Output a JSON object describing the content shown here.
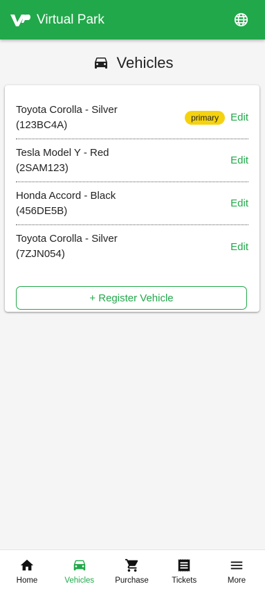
{
  "header": {
    "brand": "Virtual Park"
  },
  "page": {
    "title": "Vehicles"
  },
  "vehicles": [
    {
      "line1": "Toyota Corolla - Silver",
      "line2": "(123BC4A)",
      "badge": "primary",
      "edit": "Edit"
    },
    {
      "line1": "Tesla Model Y - Red",
      "line2": "(2SAM123)",
      "badge": "",
      "edit": "Edit"
    },
    {
      "line1": "Honda Accord - Black",
      "line2": "(456DE5B)",
      "badge": "",
      "edit": "Edit"
    },
    {
      "line1": "Toyota Corolla - Silver",
      "line2": "(7ZJN054)",
      "badge": "",
      "edit": "Edit"
    }
  ],
  "register_button": "+ Register Vehicle",
  "nav": {
    "items": [
      {
        "label": "Home",
        "icon": "home-icon"
      },
      {
        "label": "Vehicles",
        "icon": "car-icon",
        "active": true
      },
      {
        "label": "Purchase",
        "icon": "cart-icon"
      },
      {
        "label": "Tickets",
        "icon": "receipt-icon"
      },
      {
        "label": "More",
        "icon": "menu-icon"
      }
    ]
  },
  "colors": {
    "brand_green": "#21a84a",
    "badge_yellow": "#f5d20f",
    "background": "#f5f5f5"
  }
}
